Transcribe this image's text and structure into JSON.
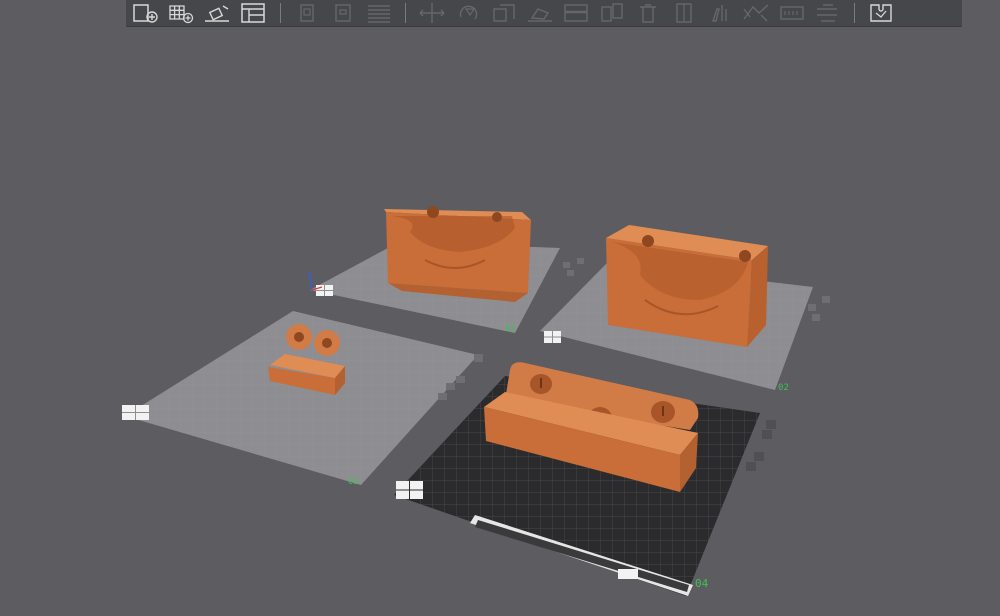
{
  "toolbar": {
    "tools": [
      {
        "icon": "add-object-icon",
        "enabled": true
      },
      {
        "icon": "add-grid-icon",
        "enabled": true
      },
      {
        "icon": "arrange-icon",
        "enabled": true
      },
      {
        "icon": "layout-icon",
        "enabled": true
      },
      {
        "icon": "copy-icon",
        "enabled": false
      },
      {
        "icon": "paste-icon",
        "enabled": false
      },
      {
        "icon": "list-icon",
        "enabled": false
      },
      {
        "icon": "move-icon",
        "enabled": false
      },
      {
        "icon": "rotate-icon",
        "enabled": false
      },
      {
        "icon": "scale-icon",
        "enabled": false
      },
      {
        "icon": "place-on-face-icon",
        "enabled": false
      },
      {
        "icon": "cut-icon",
        "enabled": false
      },
      {
        "icon": "split-icon",
        "enabled": false
      },
      {
        "icon": "delete-icon",
        "enabled": false
      },
      {
        "icon": "mirror-icon",
        "enabled": false
      },
      {
        "icon": "paint-icon",
        "enabled": false
      },
      {
        "icon": "measure-icon",
        "enabled": false
      },
      {
        "icon": "text-icon",
        "enabled": false
      },
      {
        "icon": "assembly-icon",
        "enabled": false
      },
      {
        "icon": "puzzle-icon",
        "enabled": true
      }
    ]
  },
  "plates": [
    {
      "label": "01",
      "active": false,
      "object": "box-with-cutout"
    },
    {
      "label": "02",
      "active": false,
      "object": "box-with-cutout"
    },
    {
      "label": "03",
      "active": false,
      "object": "small-holder"
    },
    {
      "label": "04",
      "active": true,
      "object": "wall-tray"
    }
  ],
  "colors": {
    "background": "#5d5c61",
    "plate_inactive": "#8d8c90",
    "plate_active": "#2a2a2c",
    "model": "#d17b46",
    "label": "#3fbf58"
  }
}
